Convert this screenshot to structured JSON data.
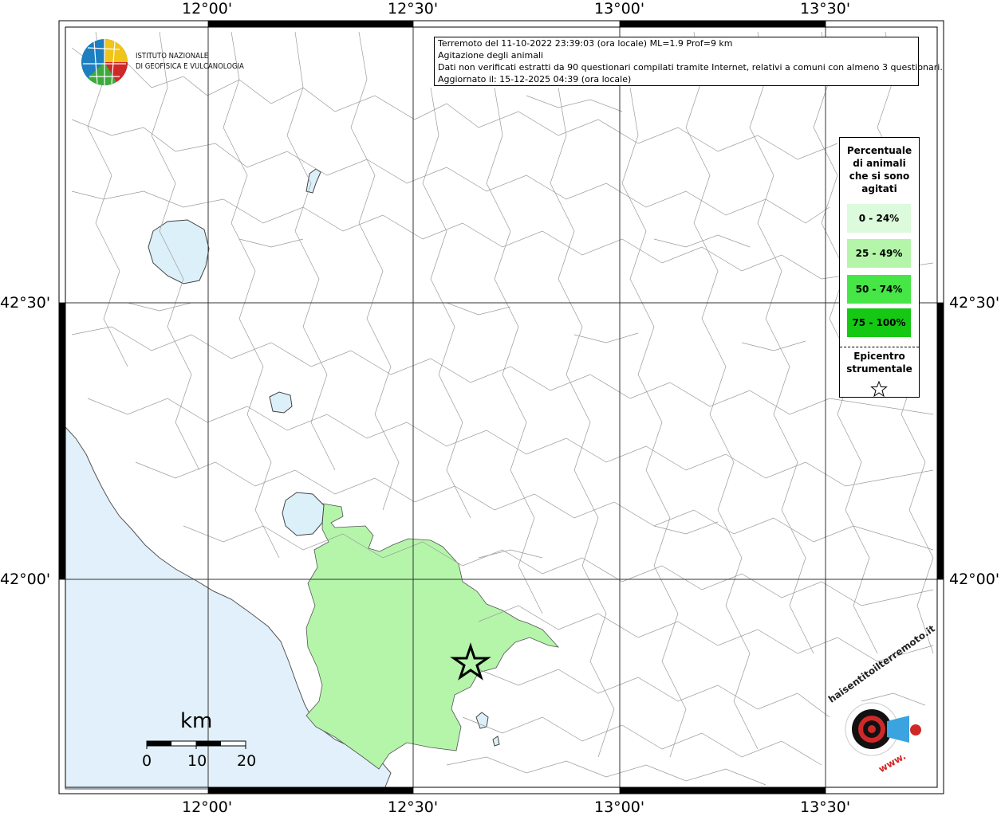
{
  "top_longitudes": [
    "12°00'",
    "12°30'",
    "13°00'",
    "13°30'"
  ],
  "bottom_longitudes": [
    "12°00'",
    "12°30'",
    "13°00'",
    "13°30'"
  ],
  "left_latitudes": [
    "42°30'",
    "42°00'"
  ],
  "right_latitudes": [
    "42°30'",
    "42°00'"
  ],
  "info": {
    "line1": "Terremoto del 11-10-2022 23:39:03 (ora locale) ML=1.9 Prof=9 km",
    "line2": "Agitazione degli animali",
    "line3": "Dati non verificati estratti da 90 questionari compilati tramite Internet, relativi a comuni con almeno 3 questionari.",
    "line4": "Aggiornato il: 15-12-2025 04:39 (ora locale)"
  },
  "legend": {
    "title": "Percentuale\ndi animali\nche si sono\nagitati",
    "classes": [
      {
        "label": "0 - 24%",
        "color": "#dcfadc"
      },
      {
        "label": "25 - 49%",
        "color": "#b4f5aa"
      },
      {
        "label": "50 - 74%",
        "color": "#46e646"
      },
      {
        "label": "75 - 100%",
        "color": "#14c814"
      }
    ],
    "epicenter_label": "Epicentro\nstrumentale"
  },
  "logo": {
    "line1": "ISTITUTO NAZIONALE",
    "line2": "DI GEOFISICA E VULCANOLOGIA",
    "hst_text": "haisentitoilterremoto.it",
    "hst_www": "www."
  },
  "scale_bar": {
    "unit": "km",
    "ticks": [
      "0",
      "10",
      "20"
    ]
  },
  "colors": {
    "sea": "#e1f0fa",
    "lake": "#dcf0fa",
    "affected_area": "#b4f5aa",
    "border": "#9a9a9a"
  }
}
